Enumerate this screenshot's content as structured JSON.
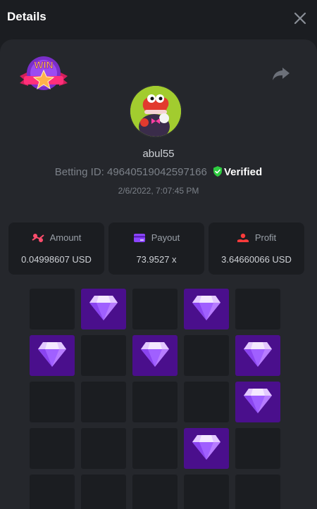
{
  "header": {
    "title": "Details"
  },
  "user": {
    "name": "abul55",
    "betting_id_label": "Betting ID:",
    "betting_id": "49640519042597166",
    "verified_label": "Verified",
    "timestamp": "2/6/2022, 7:07:45 PM"
  },
  "badge": {
    "text": "WIN"
  },
  "stats": [
    {
      "label": "Amount",
      "value": "0.04998607 USD",
      "icon": "coins-icon",
      "color": "#ff4d6d"
    },
    {
      "label": "Payout",
      "value": "73.9527 x",
      "icon": "card-icon",
      "color": "#8b44ff"
    },
    {
      "label": "Profit",
      "value": "3.64660066 USD",
      "icon": "hand-coin-icon",
      "color": "#ff3b3b"
    }
  ],
  "board": {
    "columns": 5,
    "gem_color": "#4a0f8c",
    "rows": [
      [
        "empty",
        "gem",
        "empty",
        "gem",
        "empty"
      ],
      [
        "gem",
        "empty",
        "gem",
        "empty",
        "gem"
      ],
      [
        "empty",
        "empty",
        "empty",
        "empty",
        "gem"
      ],
      [
        "empty",
        "empty",
        "empty",
        "gem",
        "empty"
      ],
      [
        "empty",
        "empty",
        "empty",
        "empty",
        "empty"
      ]
    ]
  },
  "colors": {
    "background": "#1b1d21",
    "panel": "#25272c",
    "verified": "#2ecc40",
    "accent_gem": "#b77cff"
  }
}
